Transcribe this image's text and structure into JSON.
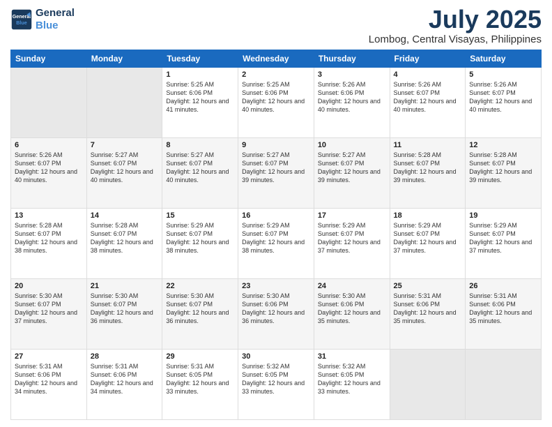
{
  "header": {
    "logo_line1": "General",
    "logo_line2": "Blue",
    "title": "July 2025",
    "subtitle": "Lombog, Central Visayas, Philippines"
  },
  "calendar": {
    "days_of_week": [
      "Sunday",
      "Monday",
      "Tuesday",
      "Wednesday",
      "Thursday",
      "Friday",
      "Saturday"
    ],
    "weeks": [
      [
        {
          "num": "",
          "empty": true
        },
        {
          "num": "",
          "empty": true
        },
        {
          "num": "1",
          "sunrise": "5:25 AM",
          "sunset": "6:06 PM",
          "daylight": "12 hours and 41 minutes."
        },
        {
          "num": "2",
          "sunrise": "5:25 AM",
          "sunset": "6:06 PM",
          "daylight": "12 hours and 40 minutes."
        },
        {
          "num": "3",
          "sunrise": "5:26 AM",
          "sunset": "6:06 PM",
          "daylight": "12 hours and 40 minutes."
        },
        {
          "num": "4",
          "sunrise": "5:26 AM",
          "sunset": "6:07 PM",
          "daylight": "12 hours and 40 minutes."
        },
        {
          "num": "5",
          "sunrise": "5:26 AM",
          "sunset": "6:07 PM",
          "daylight": "12 hours and 40 minutes."
        }
      ],
      [
        {
          "num": "6",
          "sunrise": "5:26 AM",
          "sunset": "6:07 PM",
          "daylight": "12 hours and 40 minutes."
        },
        {
          "num": "7",
          "sunrise": "5:27 AM",
          "sunset": "6:07 PM",
          "daylight": "12 hours and 40 minutes."
        },
        {
          "num": "8",
          "sunrise": "5:27 AM",
          "sunset": "6:07 PM",
          "daylight": "12 hours and 40 minutes."
        },
        {
          "num": "9",
          "sunrise": "5:27 AM",
          "sunset": "6:07 PM",
          "daylight": "12 hours and 39 minutes."
        },
        {
          "num": "10",
          "sunrise": "5:27 AM",
          "sunset": "6:07 PM",
          "daylight": "12 hours and 39 minutes."
        },
        {
          "num": "11",
          "sunrise": "5:28 AM",
          "sunset": "6:07 PM",
          "daylight": "12 hours and 39 minutes."
        },
        {
          "num": "12",
          "sunrise": "5:28 AM",
          "sunset": "6:07 PM",
          "daylight": "12 hours and 39 minutes."
        }
      ],
      [
        {
          "num": "13",
          "sunrise": "5:28 AM",
          "sunset": "6:07 PM",
          "daylight": "12 hours and 38 minutes."
        },
        {
          "num": "14",
          "sunrise": "5:28 AM",
          "sunset": "6:07 PM",
          "daylight": "12 hours and 38 minutes."
        },
        {
          "num": "15",
          "sunrise": "5:29 AM",
          "sunset": "6:07 PM",
          "daylight": "12 hours and 38 minutes."
        },
        {
          "num": "16",
          "sunrise": "5:29 AM",
          "sunset": "6:07 PM",
          "daylight": "12 hours and 38 minutes."
        },
        {
          "num": "17",
          "sunrise": "5:29 AM",
          "sunset": "6:07 PM",
          "daylight": "12 hours and 37 minutes."
        },
        {
          "num": "18",
          "sunrise": "5:29 AM",
          "sunset": "6:07 PM",
          "daylight": "12 hours and 37 minutes."
        },
        {
          "num": "19",
          "sunrise": "5:29 AM",
          "sunset": "6:07 PM",
          "daylight": "12 hours and 37 minutes."
        }
      ],
      [
        {
          "num": "20",
          "sunrise": "5:30 AM",
          "sunset": "6:07 PM",
          "daylight": "12 hours and 37 minutes."
        },
        {
          "num": "21",
          "sunrise": "5:30 AM",
          "sunset": "6:07 PM",
          "daylight": "12 hours and 36 minutes."
        },
        {
          "num": "22",
          "sunrise": "5:30 AM",
          "sunset": "6:07 PM",
          "daylight": "12 hours and 36 minutes."
        },
        {
          "num": "23",
          "sunrise": "5:30 AM",
          "sunset": "6:06 PM",
          "daylight": "12 hours and 36 minutes."
        },
        {
          "num": "24",
          "sunrise": "5:30 AM",
          "sunset": "6:06 PM",
          "daylight": "12 hours and 35 minutes."
        },
        {
          "num": "25",
          "sunrise": "5:31 AM",
          "sunset": "6:06 PM",
          "daylight": "12 hours and 35 minutes."
        },
        {
          "num": "26",
          "sunrise": "5:31 AM",
          "sunset": "6:06 PM",
          "daylight": "12 hours and 35 minutes."
        }
      ],
      [
        {
          "num": "27",
          "sunrise": "5:31 AM",
          "sunset": "6:06 PM",
          "daylight": "12 hours and 34 minutes."
        },
        {
          "num": "28",
          "sunrise": "5:31 AM",
          "sunset": "6:06 PM",
          "daylight": "12 hours and 34 minutes."
        },
        {
          "num": "29",
          "sunrise": "5:31 AM",
          "sunset": "6:05 PM",
          "daylight": "12 hours and 33 minutes."
        },
        {
          "num": "30",
          "sunrise": "5:32 AM",
          "sunset": "6:05 PM",
          "daylight": "12 hours and 33 minutes."
        },
        {
          "num": "31",
          "sunrise": "5:32 AM",
          "sunset": "6:05 PM",
          "daylight": "12 hours and 33 minutes."
        },
        {
          "num": "",
          "empty": true
        },
        {
          "num": "",
          "empty": true
        }
      ]
    ]
  }
}
